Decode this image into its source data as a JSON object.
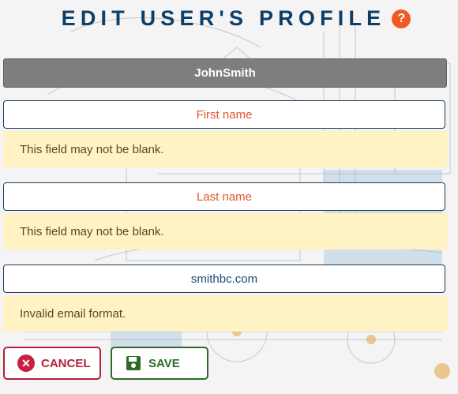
{
  "header": {
    "title": "EDIT USER'S PROFILE",
    "help_label": "?"
  },
  "user": {
    "username": "JohnSmith"
  },
  "form": {
    "first_name": {
      "placeholder": "First name",
      "value": "",
      "error": "This field may not be blank."
    },
    "last_name": {
      "placeholder": "Last name",
      "value": "",
      "error": "This field may not be blank."
    },
    "email": {
      "value": "smithbc.com",
      "error": "Invalid email format."
    }
  },
  "actions": {
    "cancel_label": "CANCEL",
    "save_label": "SAVE"
  },
  "colors": {
    "title": "#0d3e68",
    "accent_help": "#f15a24",
    "error_bg": "#fff2c5",
    "cancel": "#b21f3a",
    "save": "#2e6b2a",
    "placeholder": "#e0562e"
  },
  "icons": {
    "help": "question-icon",
    "cancel": "close-circle-icon",
    "save": "floppy-disk-icon"
  }
}
